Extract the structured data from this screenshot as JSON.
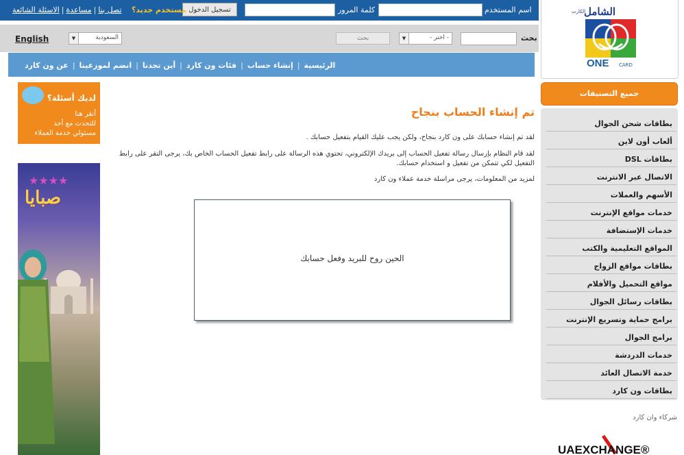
{
  "topbar": {
    "username_label": "اسم المستخدم",
    "password_label": "كلمة المرور",
    "login_button": "تسجيل الدخول",
    "new_user": "مستخدم جديد؟",
    "links": [
      "تصل بنا",
      "مساعدة",
      "الاسئلة الشائعة"
    ]
  },
  "logo": {
    "brand_ar": "الشامل",
    "brand_small": "الكارت",
    "brand_en": "ONE",
    "brand_card": "CARD"
  },
  "search": {
    "language_link": "English",
    "country_select": "السعودية",
    "category_select": "- اختر -",
    "search_button": "بحث",
    "search_label": "بحث"
  },
  "nav": {
    "items": [
      "الرئيسية",
      "إنشاء حساب",
      "فئات ون كارد",
      "أين تجدنا",
      "انضم لموزعينا",
      "عن ون كارد"
    ]
  },
  "banner_question": {
    "title": "لديك أسئلة؟",
    "lines": [
      "أنقر هنا",
      "للتحدث مع أحد",
      "مسئولي خدمة العملاء"
    ]
  },
  "banner_sabaya": {
    "title": "صبايا"
  },
  "main": {
    "title": "تم إنشاء الحساب بنجاح",
    "p1": "لقد تم إنشاء حسابك على ون كارد بنجاح، ولكن يجب عليك القيام بتفعيل حسابك .",
    "p2": "لقد قام النظام بإرسال رسالة تفعيل الحساب إلى بريدك الإلكتروني، تحتوي هذه الرسالة على رابط تفعيل الحساب الخاص بك، يرجى النقر على رابط التفعيل لكي تتمكن من تفعيل و استخدام حسابك.",
    "p3": "لمزيد من المعلومات، يرجى مراسلة خدمة عملاء ون كارد",
    "message_box": "الحين روح للبريد وفعل حسابك"
  },
  "sidebar": {
    "all_categories": "جميع التصنيفات",
    "items": [
      "بطاقات شحن الجوال",
      "ألعاب أون لاين",
      "بطاقات DSL",
      "الاتصال عبر الانترنت",
      "الأسهم والعملات",
      "خدمات مواقع الإنترنت",
      "خدمات الإستضافة",
      "المواقع التعليمية والكتب",
      "بطاقات مواقع الزواج",
      "مواقع التحميل والأفلام",
      "بطاقات رسائل الجوال",
      "برامج حماية وتسريع الإنترنت",
      "برامج الجوال",
      "خدمات الدردشة",
      "خدمة الاتصال العائد",
      "بطاقات ون كارد"
    ],
    "partners_label": "شركاء وان كارد"
  },
  "partner_logo": {
    "text": "UAEXCHANGE®"
  },
  "colors": {
    "topbar": "#1d5fa3",
    "nav": "#5b9ad0",
    "accent": "#f08a1c"
  }
}
